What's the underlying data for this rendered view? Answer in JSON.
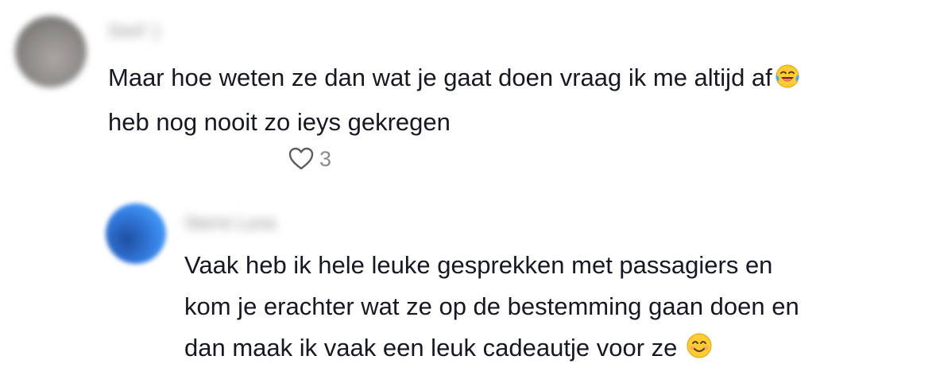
{
  "comment": {
    "author": "Soof :)",
    "lines": [
      "Maar hoe weten ze dan wat je gaat doen vraag ik me altijd af",
      "heb nog nooit zo ieys gekregen"
    ],
    "emoji_icon": "face-with-tears-of-joy-icon",
    "likes": "3"
  },
  "reply": {
    "author": "Sterre Luna",
    "lines": [
      "Vaak heb ik hele leuke gesprekken met passagiers en",
      "kom je erachter wat ze op de bestemming gaan doen en",
      "dan maak ik vaak een leuk cadeautje voor ze"
    ],
    "emoji_icon": "smiling-face-icon"
  },
  "colors": {
    "text": "#161823",
    "muted": "#8a8b91",
    "emoji_yellow": "#ffcc33"
  }
}
